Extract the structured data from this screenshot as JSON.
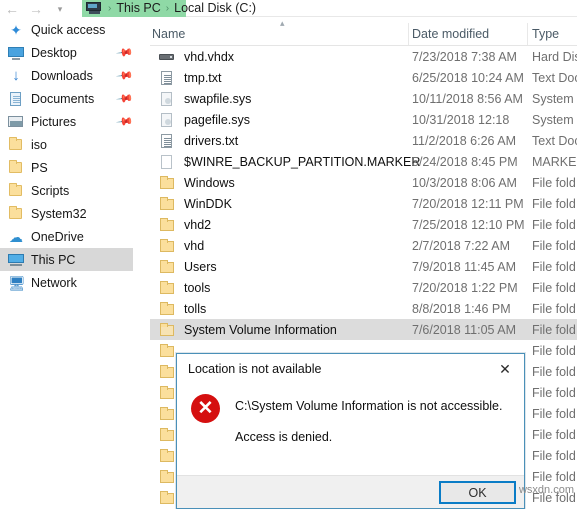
{
  "window": {
    "nav": {
      "back_icon": "arrow-left-icon",
      "forward_icon": "arrow-right-icon",
      "recent_icon": "chevron-down-icon",
      "up_icon": "arrow-up-icon"
    },
    "breadcrumb": {
      "computer_icon": "this-pc-icon",
      "highlight_color": "#8fd9a6",
      "separator": "›",
      "items": [
        {
          "label": "This PC"
        },
        {
          "label": "Local Disk (C:)"
        }
      ]
    }
  },
  "sidebar": {
    "items": [
      {
        "label": "Quick access",
        "icon": "star-pinned-icon",
        "pinned": false,
        "selected": false
      },
      {
        "label": "Desktop",
        "icon": "desktop-icon",
        "pinned": true,
        "selected": false
      },
      {
        "label": "Downloads",
        "icon": "downloads-icon",
        "pinned": true,
        "selected": false
      },
      {
        "label": "Documents",
        "icon": "documents-icon",
        "pinned": true,
        "selected": false
      },
      {
        "label": "Pictures",
        "icon": "pictures-icon",
        "pinned": true,
        "selected": false
      },
      {
        "label": "iso",
        "icon": "folder-icon",
        "pinned": false,
        "selected": false
      },
      {
        "label": "PS",
        "icon": "folder-icon",
        "pinned": false,
        "selected": false
      },
      {
        "label": "Scripts",
        "icon": "folder-icon",
        "pinned": false,
        "selected": false
      },
      {
        "label": "System32",
        "icon": "folder-icon",
        "pinned": false,
        "selected": false
      },
      {
        "label": "OneDrive",
        "icon": "onedrive-cloud-icon",
        "pinned": false,
        "selected": false
      },
      {
        "label": "This PC",
        "icon": "this-pc-icon",
        "pinned": false,
        "selected": true
      },
      {
        "label": "Network",
        "icon": "network-icon",
        "pinned": false,
        "selected": false
      }
    ],
    "pin_icon": "pin-icon"
  },
  "filelist": {
    "columns": [
      {
        "label": "Name"
      },
      {
        "label": "Date modified"
      },
      {
        "label": "Type"
      }
    ],
    "sort_chevron_icon": "chevron-up-icon",
    "rows": [
      {
        "name": "vhd.vhdx",
        "date": "7/23/2018 7:38 AM",
        "type": "Hard Dis",
        "icon": "hard-disk-image-icon",
        "selected": false
      },
      {
        "name": "tmp.txt",
        "date": "6/25/2018 10:24 AM",
        "type": "Text Doc",
        "icon": "text-document-icon",
        "selected": false
      },
      {
        "name": "swapfile.sys",
        "date": "10/11/2018 8:56 AM",
        "type": "System ",
        "icon": "system-file-icon",
        "selected": false
      },
      {
        "name": "pagefile.sys",
        "date": "10/31/2018 12:18",
        "type": "System ",
        "icon": "system-file-icon",
        "selected": false
      },
      {
        "name": "drivers.txt",
        "date": "11/2/2018 6:26 AM",
        "type": "Text Doc",
        "icon": "text-document-icon",
        "selected": false
      },
      {
        "name": "$WINRE_BACKUP_PARTITION.MARKER",
        "date": "5/24/2018 8:45 PM",
        "type": "MARKER",
        "icon": "generic-file-icon",
        "selected": false
      },
      {
        "name": "Windows",
        "date": "10/3/2018 8:06 AM",
        "type": "File fold",
        "icon": "folder-icon",
        "selected": false
      },
      {
        "name": "WinDDK",
        "date": "7/20/2018 12:11 PM",
        "type": "File fold",
        "icon": "folder-icon",
        "selected": false
      },
      {
        "name": "vhd2",
        "date": "7/25/2018 12:10 PM",
        "type": "File fold",
        "icon": "folder-icon",
        "selected": false
      },
      {
        "name": "vhd",
        "date": "2/7/2018 7:22 AM",
        "type": "File fold",
        "icon": "folder-icon",
        "selected": false
      },
      {
        "name": "Users",
        "date": "7/9/2018 11:45 AM",
        "type": "File fold",
        "icon": "folder-icon",
        "selected": false
      },
      {
        "name": "tools",
        "date": "7/20/2018 1:22 PM",
        "type": "File fold",
        "icon": "folder-icon",
        "selected": false
      },
      {
        "name": "tolls",
        "date": "8/8/2018 1:46 PM",
        "type": "File fold",
        "icon": "folder-icon",
        "selected": false
      },
      {
        "name": "System Volume Information",
        "date": "7/6/2018 11:05 AM",
        "type": "File fold",
        "icon": "folder-icon",
        "selected": true
      },
      {
        "name": "",
        "date": "",
        "type": "File fold",
        "icon": "folder-icon",
        "selected": false
      },
      {
        "name": "",
        "date": "",
        "type": "File fold",
        "icon": "folder-icon",
        "selected": false
      },
      {
        "name": "",
        "date": "",
        "type": "File fold",
        "icon": "folder-icon",
        "selected": false
      },
      {
        "name": "",
        "date": "",
        "type": "File fold",
        "icon": "folder-icon",
        "selected": false
      },
      {
        "name": "",
        "date": "",
        "type": "File fold",
        "icon": "folder-icon",
        "selected": false
      },
      {
        "name": "",
        "date": "",
        "type": "File fold",
        "icon": "folder-icon",
        "selected": false
      },
      {
        "name": "",
        "date": "",
        "type": "File fold",
        "icon": "folder-icon",
        "selected": false
      },
      {
        "name": "",
        "date": "",
        "type": "File fold",
        "icon": "folder-icon",
        "selected": false
      }
    ]
  },
  "dialog": {
    "title": "Location is not available",
    "close_icon": "close-icon",
    "error_icon": "error-cross-icon",
    "message_line1": "C:\\System Volume Information is not accessible.",
    "message_line2": "Access is denied.",
    "ok_label": "OK",
    "focus_color": "#0a7cc6",
    "error_color": "#d50f0f"
  },
  "watermark": {
    "text": "wsxdn.com"
  }
}
